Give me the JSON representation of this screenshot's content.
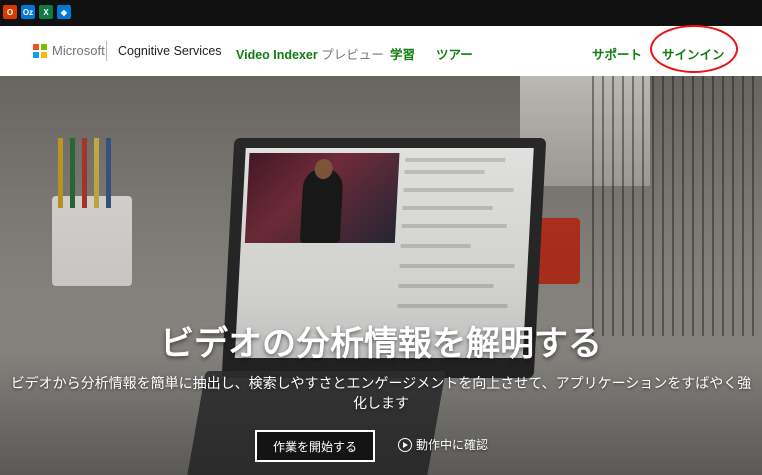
{
  "taskbar": {
    "icons": [
      {
        "name": "office-icon",
        "color": "#d83b01",
        "glyph": "O"
      },
      {
        "name": "outlook-icon",
        "color": "#0078d4",
        "glyph": "Oz"
      },
      {
        "name": "excel-icon",
        "color": "#107c41",
        "glyph": "X"
      },
      {
        "name": "azure-devops-icon",
        "color": "#0078d4",
        "glyph": "◆"
      }
    ]
  },
  "nav": {
    "brand": "Microsoft",
    "product": "Cognitive Services",
    "video_indexer": "Video Indexer",
    "preview": "プレビュー",
    "learn": "学習",
    "tour": "ツアー",
    "support": "サポート",
    "signin": "サインイン"
  },
  "hero": {
    "headline": "ビデオの分析情報を解明する",
    "subtext": "ビデオから分析情報を簡単に抽出し、検索しやすさとエンゲージメントを向上させて、アプリケーションをすばやく強化します",
    "cta_label": "作業を開始する",
    "watch_label": "動作中に確認"
  },
  "colors": {
    "accent_green": "#107c10",
    "highlight_circle": "#e11111"
  }
}
